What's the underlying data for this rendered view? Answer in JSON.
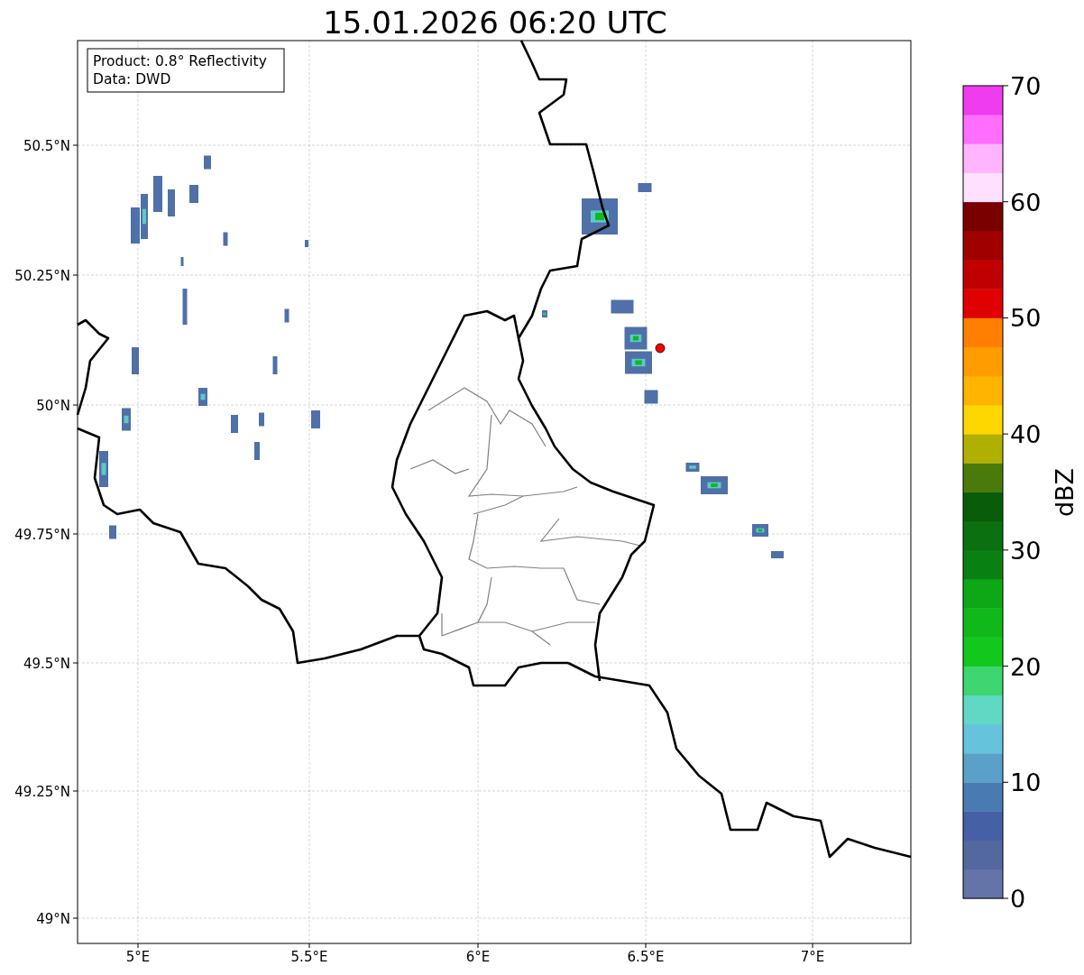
{
  "title": "15.01.2026 06:20 UTC",
  "info_box": [
    "Product: 0.8° Reflectivity",
    "Data: DWD"
  ],
  "map": {
    "x_ticks": [
      "5°E",
      "5.5°E",
      "6°E",
      "6.5°E",
      "7°E"
    ],
    "y_ticks": [
      "50.5°N",
      "50.25°N",
      "50°N",
      "49.75°N",
      "49.5°N",
      "49.25°N",
      "49°N"
    ]
  },
  "colorbar": {
    "label": "dBZ",
    "ticks": [
      "70",
      "60",
      "50",
      "40",
      "30",
      "20",
      "10",
      "0"
    ],
    "bands": [
      {
        "color": "#6574a8"
      },
      {
        "color": "#5468a0"
      },
      {
        "color": "#4560a4"
      },
      {
        "color": "#4a7ab2"
      },
      {
        "color": "#5ba0c8"
      },
      {
        "color": "#66c3dc"
      },
      {
        "color": "#60d8c4"
      },
      {
        "color": "#3dd670"
      },
      {
        "color": "#12c81c"
      },
      {
        "color": "#10b81a"
      },
      {
        "color": "#0ea817"
      },
      {
        "color": "#0b8012"
      },
      {
        "color": "#0a7010"
      },
      {
        "color": "#085c0a"
      },
      {
        "color": "#4a7a0a"
      },
      {
        "color": "#b0b003"
      },
      {
        "color": "#ffd700"
      },
      {
        "color": "#ffb400"
      },
      {
        "color": "#ff9c00"
      },
      {
        "color": "#ff8000"
      },
      {
        "color": "#e00000"
      },
      {
        "color": "#c00000"
      },
      {
        "color": "#a00000"
      },
      {
        "color": "#7a0000"
      },
      {
        "color": "#ffe0ff"
      },
      {
        "color": "#ffb4ff"
      },
      {
        "color": "#ff6eff"
      },
      {
        "color": "#ee3cee"
      }
    ]
  }
}
